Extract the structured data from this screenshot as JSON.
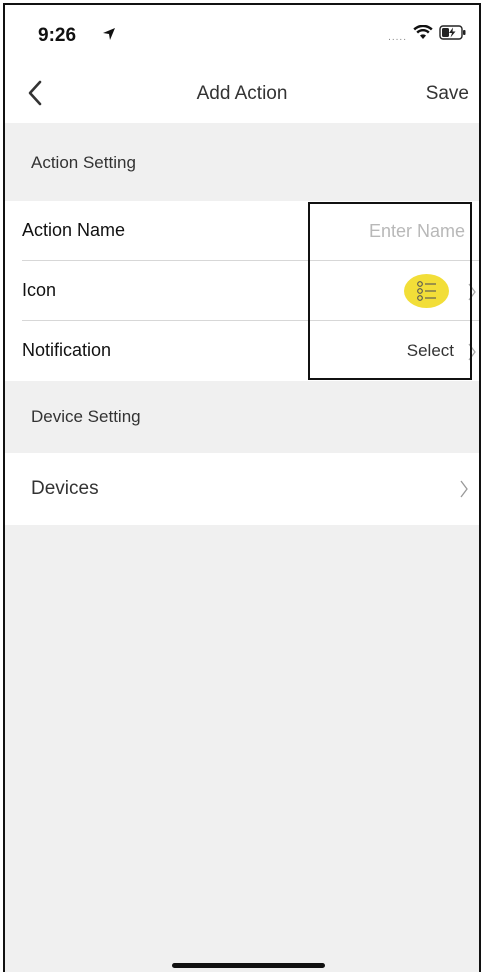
{
  "status_bar": {
    "time": "9:26",
    "signal": "....."
  },
  "nav": {
    "title": "Add Action",
    "save_label": "Save"
  },
  "sections": {
    "action_setting": "Action Setting",
    "device_setting": "Device Setting"
  },
  "action_rows": {
    "name_label": "Action Name",
    "name_placeholder": "Enter Name",
    "icon_label": "Icon",
    "notification_label": "Notification",
    "notification_value": "Select"
  },
  "device_rows": {
    "devices_label": "Devices"
  },
  "colors": {
    "background": "#f0f0f0",
    "icon_accent": "#f2de38"
  }
}
